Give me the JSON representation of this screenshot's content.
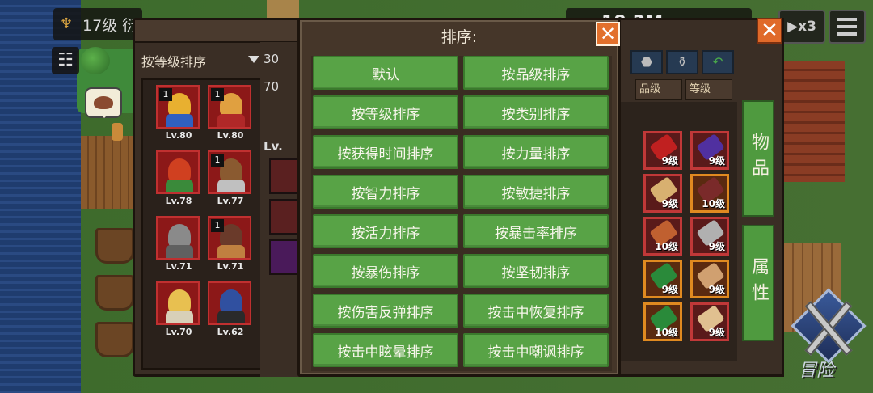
{
  "hud": {
    "player_level": "17级 衍",
    "gold_amount": "18.2M",
    "speed_label": "▶x3",
    "menu_icon": "menu-icon",
    "clipboard_icon": "clipboard-icon"
  },
  "character_panel": {
    "sort_dropdown_label": "按等级排序",
    "characters": [
      {
        "level": "Lv.80",
        "badge": "1",
        "hair": "#e8b030",
        "outfit": "#3060c0"
      },
      {
        "level": "Lv.80",
        "badge": "1",
        "hair": "#e0a040",
        "outfit": "#b02828"
      },
      {
        "level": "Lv.78",
        "badge": "",
        "hair": "#d04020",
        "outfit": "#3a8a3a"
      },
      {
        "level": "Lv.77",
        "badge": "1",
        "hair": "#8a5a30",
        "outfit": "#c0c0c0"
      },
      {
        "level": "Lv.71",
        "badge": "",
        "hair": "#8a8a8a",
        "outfit": "#606060"
      },
      {
        "level": "Lv.71",
        "badge": "1",
        "hair": "#6a3a2a",
        "outfit": "#c08040"
      },
      {
        "level": "Lv.70",
        "badge": "",
        "hair": "#e8c050",
        "outfit": "#d8d0b8"
      },
      {
        "level": "Lv.62",
        "badge": "",
        "hair": "#3050a0",
        "outfit": "#2a2a2a"
      }
    ]
  },
  "middle_panel": {
    "resource_1": "30",
    "resource_2": "70",
    "level_label": "Lv."
  },
  "sort_dialog": {
    "title": "排序:",
    "close_label": "✕",
    "options": [
      "默认",
      "按品级排序",
      "按等级排序",
      "按类别排序",
      "按获得时间排序",
      "按力量排序",
      "按智力排序",
      "按敏捷排序",
      "按活力排序",
      "按暴击率排序",
      "按暴伤排序",
      "按坚韧排序",
      "按伤害反弹排序",
      "按击中恢复排序",
      "按击中眩晕排序",
      "按击中嘲讽排序"
    ]
  },
  "inventory_panel": {
    "close_label": "✕",
    "sort_tag_quality": "品级",
    "sort_tag_level": "等级",
    "tab_items": "物品",
    "tab_attributes": "属性",
    "items": [
      {
        "level": "9级",
        "rarity": "red",
        "color": "#c02020"
      },
      {
        "level": "9级",
        "rarity": "red",
        "color": "#5030a0"
      },
      {
        "level": "9级",
        "rarity": "red",
        "color": "#d8b070"
      },
      {
        "level": "10级",
        "rarity": "orange",
        "color": "#7a2a2a"
      },
      {
        "level": "10级",
        "rarity": "red",
        "color": "#c06030"
      },
      {
        "level": "9级",
        "rarity": "red",
        "color": "#b0b0b0"
      },
      {
        "level": "9级",
        "rarity": "orange",
        "color": "#2a8a3a"
      },
      {
        "level": "9级",
        "rarity": "orange",
        "color": "#d0a070"
      },
      {
        "level": "10级",
        "rarity": "orange",
        "color": "#2a8a3a"
      },
      {
        "level": "9级",
        "rarity": "red",
        "color": "#e0c090"
      }
    ]
  },
  "adventure_label": "冒险",
  "colors": {
    "button_green": "#58a346",
    "close_orange": "#e2702c",
    "panel_brown": "#453629"
  }
}
